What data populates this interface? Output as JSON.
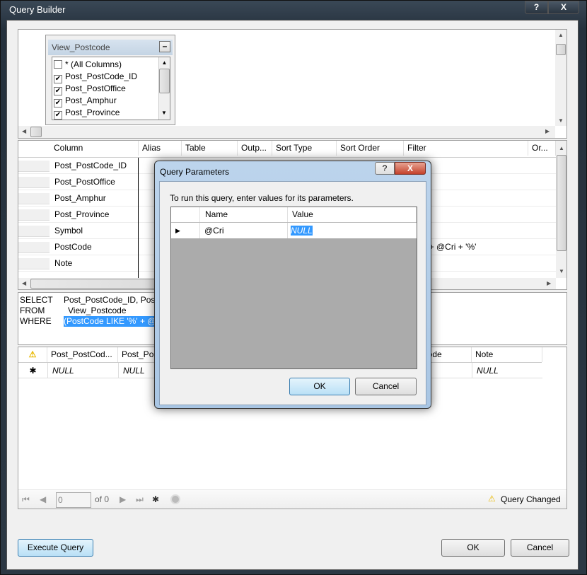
{
  "window": {
    "title": "Query Builder",
    "help": "?",
    "close": "X"
  },
  "diagram": {
    "table_name": "View_Postcode",
    "collapse": "–",
    "columns": [
      {
        "label": "* (All Columns)",
        "checked": false
      },
      {
        "label": "Post_PostCode_ID",
        "checked": true
      },
      {
        "label": "Post_PostOffice",
        "checked": true
      },
      {
        "label": "Post_Amphur",
        "checked": true
      },
      {
        "label": "Post_Province",
        "checked": true
      }
    ]
  },
  "criteria": {
    "headers": [
      "Column",
      "Alias",
      "Table",
      "Outp...",
      "Sort Type",
      "Sort Order",
      "Filter",
      "Or..."
    ],
    "rows": [
      "Post_PostCode_ID",
      "Post_PostOffice",
      "Post_Amphur",
      "Post_Province",
      "Symbol",
      "PostCode",
      "Note"
    ],
    "postcode_filter": "' + @Cri + '%'"
  },
  "sql": {
    "select_kw": "SELECT",
    "select": "Post_PostCode_ID, Post_",
    "from_kw": "FROM",
    "from": "View_Postcode",
    "where_kw": "WHERE",
    "where": "(PostCode LIKE '%' + @C"
  },
  "results": {
    "headers": [
      "Post_PostCod...",
      "Post_Po",
      "PostCode",
      "Note"
    ],
    "row": [
      "NULL",
      "NULL",
      "NULL"
    ],
    "new_row_marker": "✱"
  },
  "navigator": {
    "position": "0",
    "of": "of 0",
    "status": "Query Changed"
  },
  "buttons": {
    "execute": "Execute Query",
    "ok": "OK",
    "cancel": "Cancel"
  },
  "dialog": {
    "title": "Query Parameters",
    "help": "?",
    "close": "X",
    "instruction": "To run this query, enter values for its parameters.",
    "headers": [
      "Name",
      "Value"
    ],
    "param_name": "@Cri",
    "param_value": "NULL",
    "ok": "OK",
    "cancel": "Cancel"
  }
}
